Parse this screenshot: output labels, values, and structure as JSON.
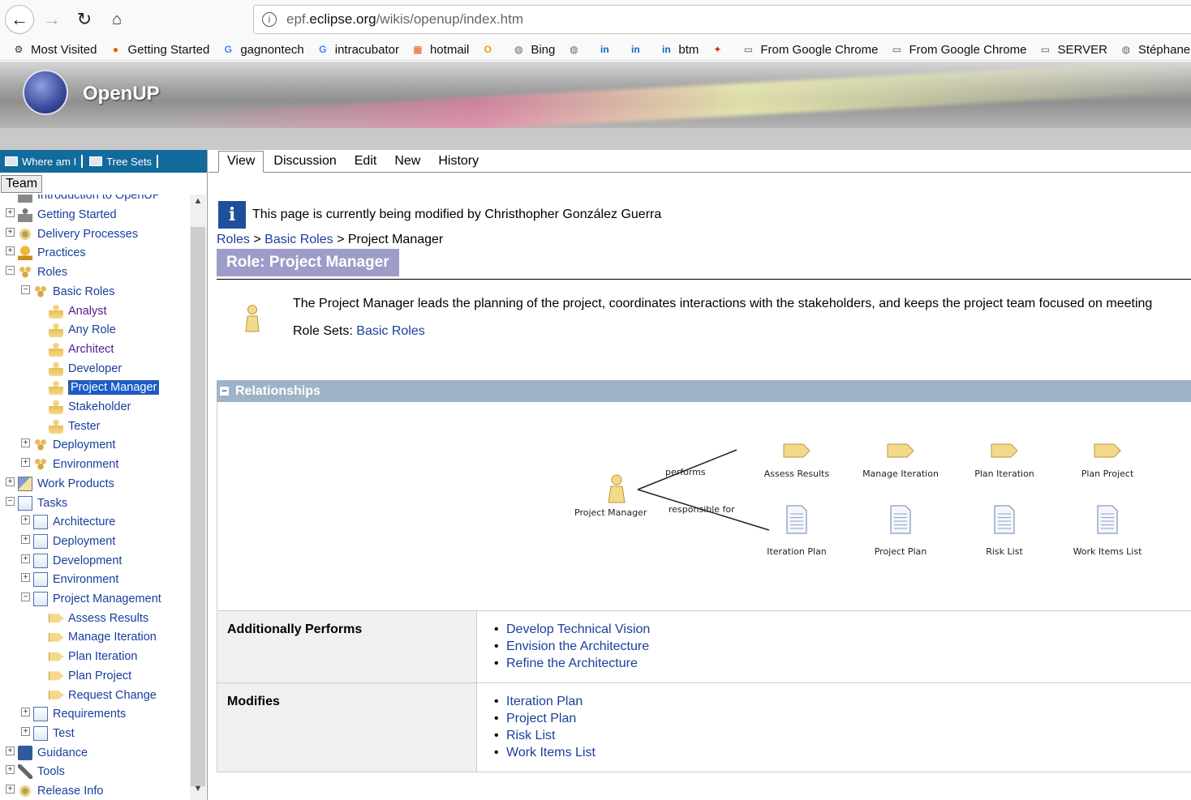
{
  "browser": {
    "url_prefix": "epf.",
    "url_domain": "eclipse.org",
    "url_path": "/wikis/openup/index.htm",
    "bookmarks": [
      {
        "label": "Most Visited",
        "icon": "gear-icon"
      },
      {
        "label": "Getting Started",
        "icon": "firefox-icon"
      },
      {
        "label": "gagnontech",
        "icon": "google-icon"
      },
      {
        "label": "intracubator",
        "icon": "google-icon"
      },
      {
        "label": "hotmail",
        "icon": "windows-icon"
      },
      {
        "label": "",
        "icon": "outlook-icon"
      },
      {
        "label": "Bing",
        "icon": "globe-icon"
      },
      {
        "label": "",
        "icon": "globe-icon"
      },
      {
        "label": "",
        "icon": "linkedin-icon"
      },
      {
        "label": "",
        "icon": "linkedin-icon"
      },
      {
        "label": "btm",
        "icon": "linkedin-icon"
      },
      {
        "label": "",
        "icon": "maple-leaf-icon"
      },
      {
        "label": "From Google Chrome",
        "icon": "folder-icon"
      },
      {
        "label": "From Google Chrome",
        "icon": "folder-icon"
      },
      {
        "label": "SERVER",
        "icon": "folder-icon"
      },
      {
        "label": "Stéphane",
        "icon": "globe-icon"
      }
    ]
  },
  "banner": {
    "brand": "OpenUP"
  },
  "left": {
    "where_am_i": "Where am I",
    "tree_sets": "Tree Sets",
    "team_tab": "Team",
    "tree": [
      {
        "label": "Introduction to OpenUP",
        "level": 0,
        "icon": "person",
        "exp": "",
        "partial": true
      },
      {
        "label": "Getting Started",
        "level": 0,
        "icon": "person",
        "exp": "+"
      },
      {
        "label": "Delivery Processes",
        "level": 0,
        "icon": "gear",
        "exp": "+"
      },
      {
        "label": "Practices",
        "level": 0,
        "icon": "trophy",
        "exp": "+"
      },
      {
        "label": "Roles",
        "level": 0,
        "icon": "roles",
        "exp": "-"
      },
      {
        "label": "Basic Roles",
        "level": 1,
        "icon": "roles",
        "exp": "-"
      },
      {
        "label": "Analyst",
        "level": 2,
        "icon": "role",
        "exp": "",
        "visited": true
      },
      {
        "label": "Any Role",
        "level": 2,
        "icon": "role",
        "exp": ""
      },
      {
        "label": "Architect",
        "level": 2,
        "icon": "role",
        "exp": "",
        "visited": true
      },
      {
        "label": "Developer",
        "level": 2,
        "icon": "role",
        "exp": ""
      },
      {
        "label": "Project Manager",
        "level": 2,
        "icon": "role",
        "exp": "",
        "selected": true
      },
      {
        "label": "Stakeholder",
        "level": 2,
        "icon": "role",
        "exp": ""
      },
      {
        "label": "Tester",
        "level": 2,
        "icon": "role",
        "exp": ""
      },
      {
        "label": "Deployment",
        "level": 1,
        "icon": "roles",
        "exp": "+"
      },
      {
        "label": "Environment",
        "level": 1,
        "icon": "roles",
        "exp": "+"
      },
      {
        "label": "Work Products",
        "level": 0,
        "icon": "wp",
        "exp": "+"
      },
      {
        "label": "Tasks",
        "level": 0,
        "icon": "taskset",
        "exp": "-"
      },
      {
        "label": "Architecture",
        "level": 1,
        "icon": "taskset",
        "exp": "+"
      },
      {
        "label": "Deployment",
        "level": 1,
        "icon": "taskset",
        "exp": "+"
      },
      {
        "label": "Development",
        "level": 1,
        "icon": "taskset",
        "exp": "+"
      },
      {
        "label": "Environment",
        "level": 1,
        "icon": "taskset",
        "exp": "+"
      },
      {
        "label": "Project Management",
        "level": 1,
        "icon": "taskset",
        "exp": "-"
      },
      {
        "label": "Assess Results",
        "level": 2,
        "icon": "arrow",
        "exp": ""
      },
      {
        "label": "Manage Iteration",
        "level": 2,
        "icon": "arrow",
        "exp": ""
      },
      {
        "label": "Plan Iteration",
        "level": 2,
        "icon": "arrow",
        "exp": ""
      },
      {
        "label": "Plan Project",
        "level": 2,
        "icon": "arrow",
        "exp": ""
      },
      {
        "label": "Request Change",
        "level": 2,
        "icon": "arrow",
        "exp": ""
      },
      {
        "label": "Requirements",
        "level": 1,
        "icon": "taskset",
        "exp": "+"
      },
      {
        "label": "Test",
        "level": 1,
        "icon": "taskset",
        "exp": "+"
      },
      {
        "label": "Guidance",
        "level": 0,
        "icon": "book",
        "exp": "+"
      },
      {
        "label": "Tools",
        "level": 0,
        "icon": "tool",
        "exp": "+"
      },
      {
        "label": "Release Info",
        "level": 0,
        "icon": "gear",
        "exp": "+"
      }
    ]
  },
  "tabs": [
    "View",
    "Discussion",
    "Edit",
    "New",
    "History"
  ],
  "notice": "This page is currently being modified by Christhopher González Guerra",
  "breadcrumb": {
    "roles": "Roles",
    "sep1": " > ",
    "basic": "Basic Roles",
    "sep2": " > ",
    "current": "Project Manager"
  },
  "title": "Role: Project Manager",
  "description": "The Project Manager leads the planning of the project, coordinates interactions with the stakeholders, and keeps the project team focused on meeting",
  "role_sets": {
    "label": "Role Sets: ",
    "value": "Basic Roles"
  },
  "relationships": {
    "header": "Relationships",
    "diagram": {
      "role": "Project Manager",
      "performs_label": "performs",
      "responsible_label": "responsible for",
      "tasks": [
        "Assess Results",
        "Manage Iteration",
        "Plan Iteration",
        "Plan Project"
      ],
      "artifacts": [
        "Iteration Plan",
        "Project Plan",
        "Risk List",
        "Work Items List"
      ]
    },
    "additionally_performs": {
      "label": "Additionally Performs",
      "items": [
        "Develop Technical Vision",
        "Envision the Architecture",
        "Refine the Architecture"
      ]
    },
    "modifies": {
      "label": "Modifies",
      "items": [
        "Iteration Plan",
        "Project Plan",
        "Risk List",
        "Work Items List"
      ]
    }
  }
}
